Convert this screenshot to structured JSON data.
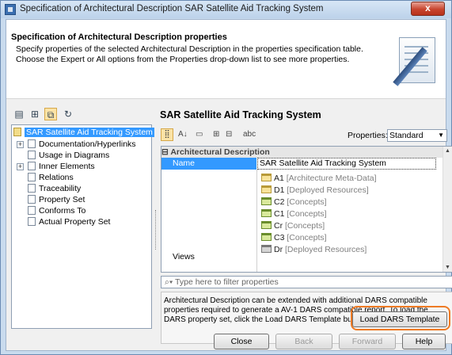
{
  "window": {
    "title": "Specification of Architectural Description SAR Satellite Aid Tracking System",
    "close_glyph": "x"
  },
  "header": {
    "title": "Specification of Architectural Description properties",
    "desc_line1": "Specify properties of the selected Architectural Description in the properties specification table.",
    "desc_line2": "Choose the Expert or All options from the Properties drop-down list to see more properties."
  },
  "tree": {
    "items": [
      {
        "label": "SAR Satellite Aid Tracking System",
        "selected": true
      },
      {
        "label": "Documentation/Hyperlinks"
      },
      {
        "label": "Usage in Diagrams"
      },
      {
        "label": "Inner Elements"
      },
      {
        "label": "Relations"
      },
      {
        "label": "Traceability"
      },
      {
        "label": "Property Set"
      },
      {
        "label": "Conforms To"
      },
      {
        "label": "Actual Property Set"
      }
    ]
  },
  "panel": {
    "title": "SAR Satellite Aid Tracking System",
    "properties_label": "Properties:",
    "properties_value": "Standard",
    "group_label": "Architectural Description",
    "name_label": "Name",
    "name_value": "SAR Satellite Aid Tracking System",
    "views_label": "Views",
    "views": [
      {
        "name": "A1",
        "meta": "[Architecture Meta-Data]",
        "color": "yellow"
      },
      {
        "name": "D1",
        "meta": "[Deployed Resources]",
        "color": "yellow"
      },
      {
        "name": "C2",
        "meta": "[Concepts]",
        "color": "green"
      },
      {
        "name": "C1",
        "meta": "[Concepts]",
        "color": "green"
      },
      {
        "name": "Cr",
        "meta": "[Concepts]",
        "color": "green"
      },
      {
        "name": "C3",
        "meta": "[Concepts]",
        "color": "green"
      },
      {
        "name": "Dr",
        "meta": "[Deployed Resources]",
        "color": "gray"
      }
    ],
    "filter_placeholder": "Type here to filter properties",
    "description": "Architectural Description can be extended with additional DARS compatible properties required to generate a AV-1 DARS compatible report. To load the DARS property set, click the Load DARS Template button."
  },
  "buttons": {
    "load_dars": "Load DARS Template",
    "close": "Close",
    "back": "Back",
    "forward": "Forward",
    "help": "Help"
  },
  "colors": {
    "selection": "#3399ff",
    "highlight": "#ee7a24"
  }
}
